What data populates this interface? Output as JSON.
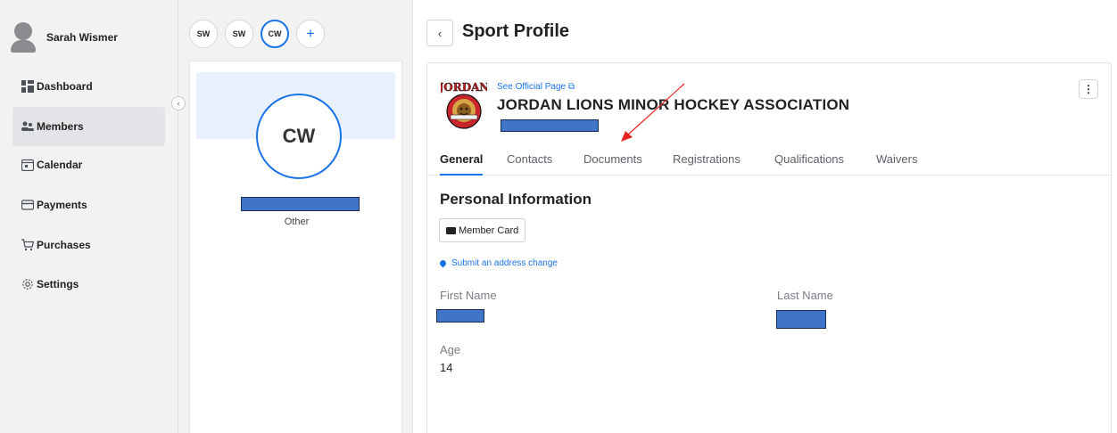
{
  "sidebar": {
    "user_name": "Sarah Wismer",
    "collapse_icon": "chevron-left-icon",
    "items": [
      {
        "label": "Dashboard",
        "icon": "dashboard-icon"
      },
      {
        "label": "Members",
        "icon": "members-icon",
        "active": true
      },
      {
        "label": "Calendar",
        "icon": "calendar-icon"
      },
      {
        "label": "Payments",
        "icon": "payment-card-icon"
      },
      {
        "label": "Purchases",
        "icon": "cart-icon"
      },
      {
        "label": "Settings",
        "icon": "gear-icon"
      }
    ]
  },
  "members": {
    "chips": [
      {
        "label": "SW",
        "active": false
      },
      {
        "label": "SW",
        "active": false
      },
      {
        "label": "CW",
        "active": true
      }
    ],
    "add_label": "+",
    "selected": {
      "initials": "CW",
      "type": "Other"
    }
  },
  "header": {
    "back_icon": "‹",
    "title": "Sport Profile"
  },
  "organization": {
    "official_link": "See Official Page ⧉",
    "name": "JORDAN LIONS MINOR HOCKEY ASSOCIATION",
    "menu_icon": "⋮",
    "logo_text": "JORDAN"
  },
  "tabs": [
    {
      "label": "General",
      "active": true
    },
    {
      "label": "Contacts"
    },
    {
      "label": "Documents"
    },
    {
      "label": "Registrations"
    },
    {
      "label": "Qualifications"
    },
    {
      "label": "Waivers"
    }
  ],
  "personal_info": {
    "section_title": "Personal Information",
    "member_card_label": "Member Card",
    "address_change_label": "Submit an address change",
    "first_name_label": "First Name",
    "last_name_label": "Last Name",
    "age_label": "Age",
    "age_value": "14"
  },
  "colors": {
    "accent": "#1a73e8",
    "redaction": "#3f74c8",
    "annotation_arrow": "#e8231f"
  }
}
